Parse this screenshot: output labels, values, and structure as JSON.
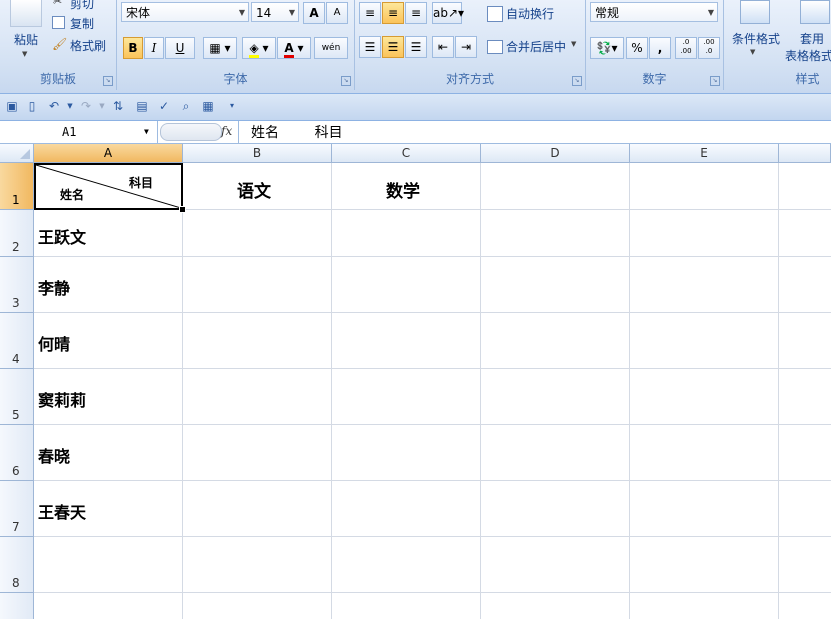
{
  "ribbon": {
    "clipboard": {
      "paste": "粘贴",
      "cut": "剪切",
      "copy": "复制",
      "format_painter": "格式刷",
      "label": "剪贴板"
    },
    "font": {
      "name": "宋体",
      "size": "14",
      "bold": "B",
      "italic": "I",
      "underline": "U",
      "grow": "A",
      "shrink": "A",
      "font_color": "A",
      "phonetic": "wén",
      "label": "字体"
    },
    "alignment": {
      "wrap": "自动换行",
      "merge": "合并后居中",
      "label": "对齐方式"
    },
    "number": {
      "format": "常规",
      "percent": "%",
      "comma": ",",
      "inc_decimal": ".0 .00",
      "dec_decimal": ".00 .0",
      "label": "数字"
    },
    "styles": {
      "conditional": "条件格式",
      "table": "套用",
      "table2": "表格格式",
      "label": "样式"
    }
  },
  "formula_bar": {
    "name_box": "A1",
    "fx": "fx",
    "content": "姓名        科目"
  },
  "columns": [
    "A",
    "B",
    "C",
    "D",
    "E"
  ],
  "rows": [
    "1",
    "2",
    "3",
    "4",
    "5",
    "6",
    "7",
    "8"
  ],
  "cells": {
    "a1_top": "科目",
    "a1_bottom": "姓名",
    "b1": "语文",
    "c1": "数学",
    "a2": "王跃文",
    "a3": "李静",
    "a4": "何晴",
    "a5": "窦莉莉",
    "a6": "春晓",
    "a7": "王春天"
  },
  "colors": {
    "ribbon_bg": "#d3e1f3",
    "selected_header": "#f1b860",
    "grid_line": "#d4dae4"
  }
}
